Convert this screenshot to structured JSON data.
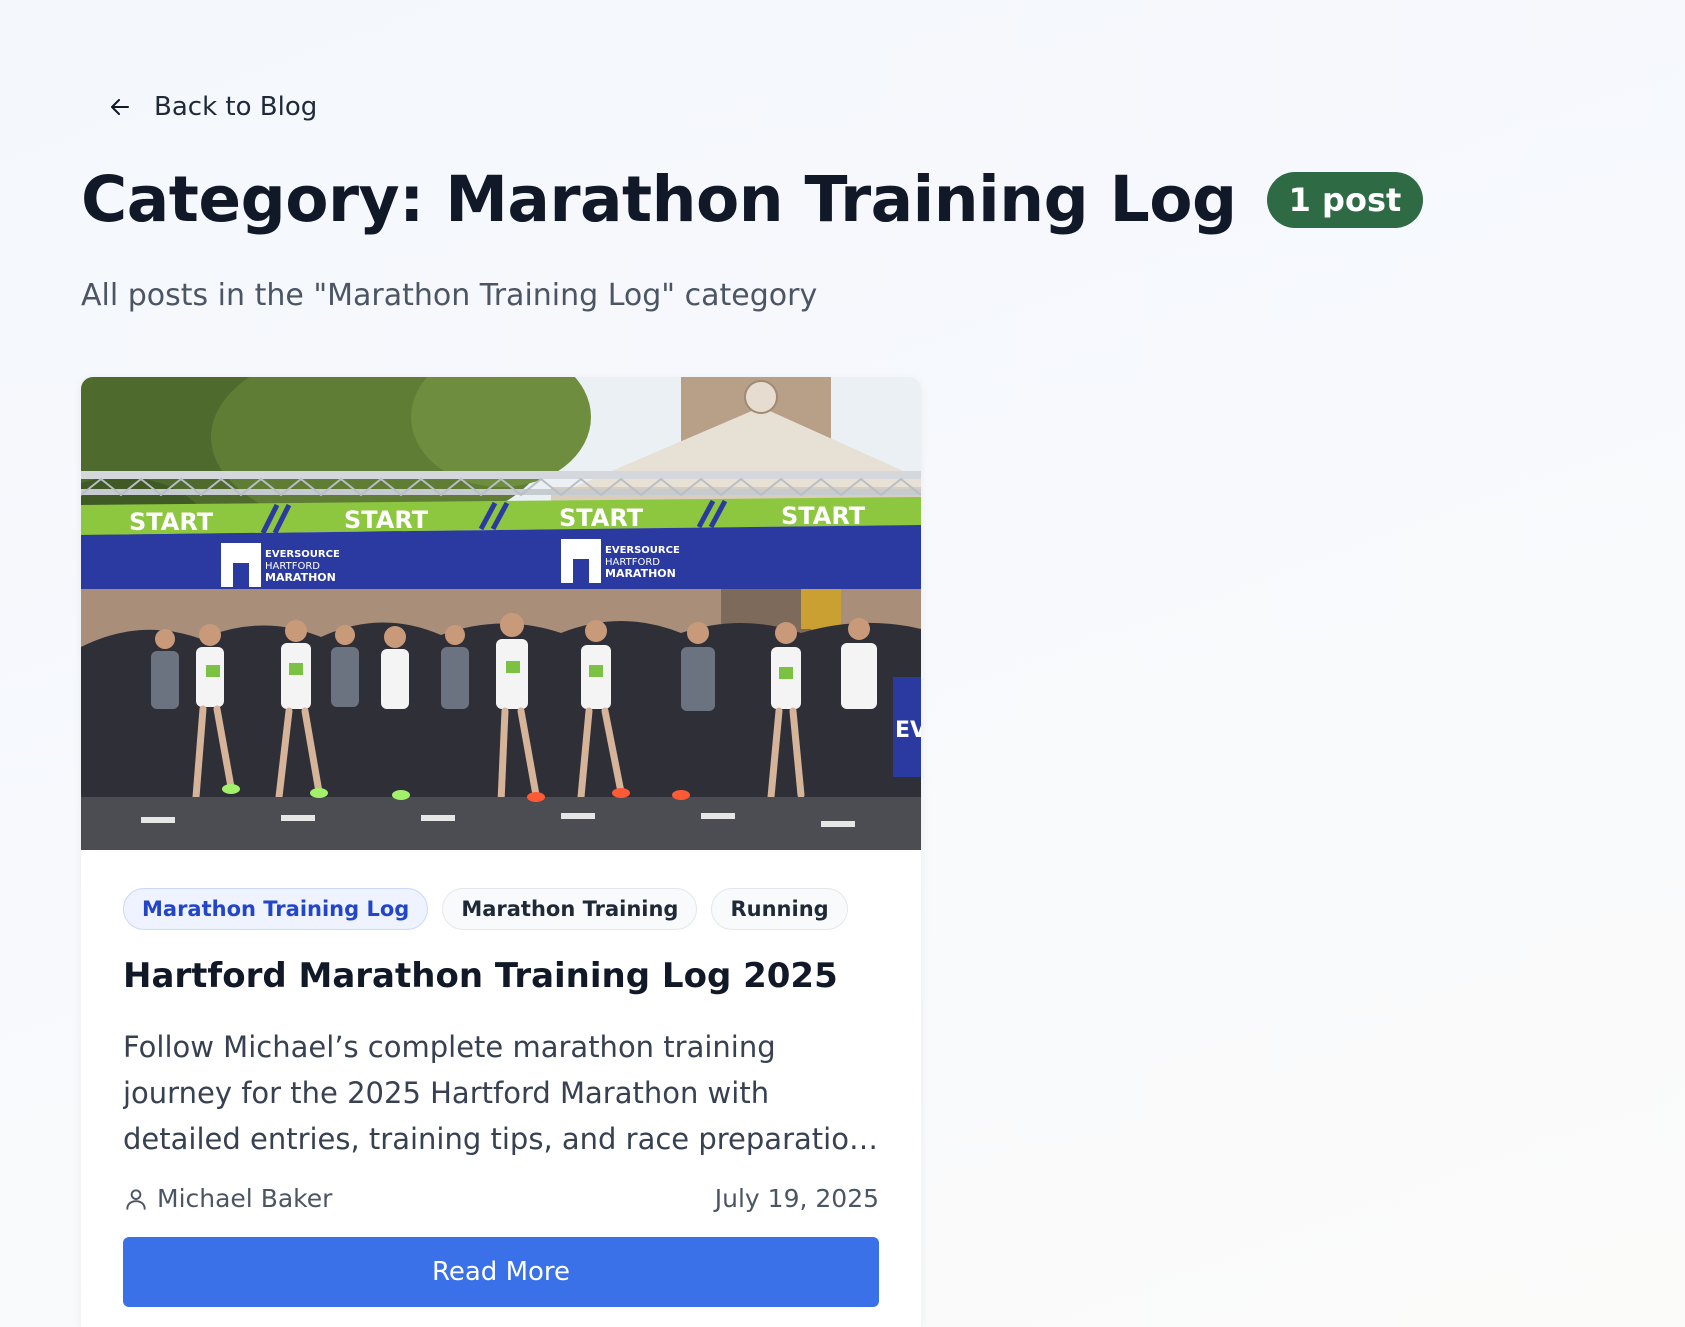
{
  "nav": {
    "back_label": "Back to Blog"
  },
  "header": {
    "title": "Category: Marathon Training Log",
    "count_badge": "1 post",
    "subtitle": "All posts in the \"Marathon Training Log\" category"
  },
  "posts": [
    {
      "image": {
        "banner_text": "START",
        "sponsor_lines": [
          "EVERSOURCE",
          "HARTFORD",
          "MARATHON"
        ],
        "side_sign": "EV"
      },
      "tags": [
        "Marathon Training Log",
        "Marathon Training",
        "Running"
      ],
      "title": "Hartford Marathon Training Log 2025",
      "excerpt": "Follow Michael’s complete marathon training journey for the 2025 Hartford Marathon with detailed entries, training tips, and race preparation insights.",
      "author": "Michael Baker",
      "date": "July 19, 2025",
      "read_more_label": "Read More"
    }
  ],
  "colors": {
    "badge": "#2e6a44",
    "primary_button": "#3a71e8",
    "active_tag_text": "#2346c9",
    "banner_green": "#8dc63f",
    "banner_blue": "#2b3aa0"
  }
}
